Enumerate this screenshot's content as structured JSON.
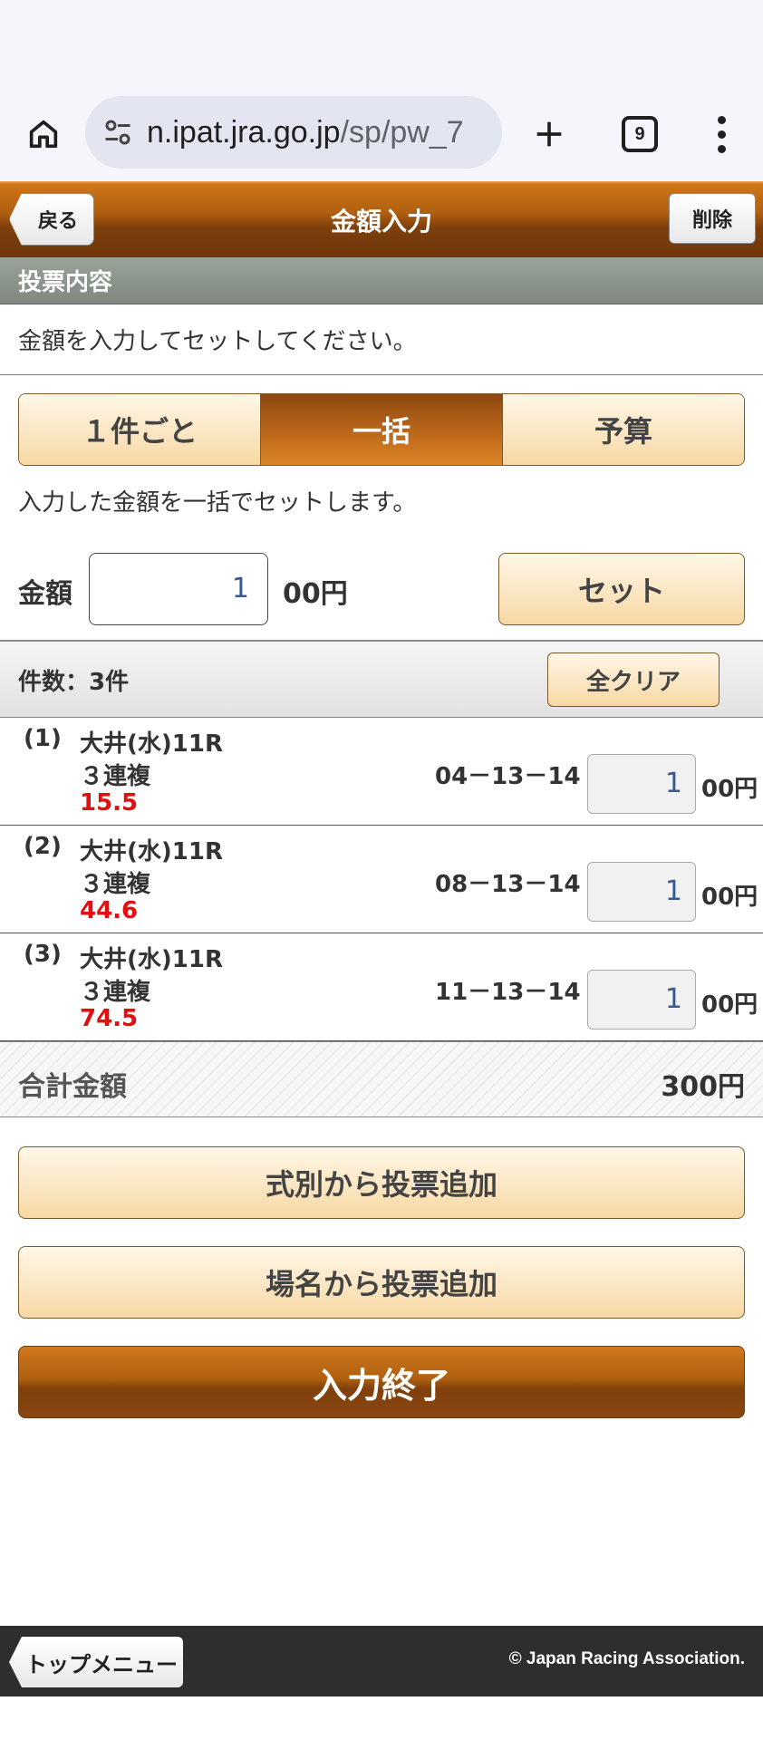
{
  "browser": {
    "url_host": "n.ipat.jra.go.jp",
    "url_path": "/sp/pw_7",
    "tab_count": "9",
    "icons": [
      "home-icon",
      "site-settings-icon",
      "plus-icon",
      "tabs-icon",
      "more-vert-icon"
    ]
  },
  "header": {
    "back_label": "戻る",
    "title": "金額入力",
    "delete_label": "削除"
  },
  "section": {
    "title": "投票内容",
    "instruction": "金額を入力してセットしてください。"
  },
  "mode_tabs": [
    {
      "label": "１件ごと",
      "active": false
    },
    {
      "label": "一括",
      "active": true
    },
    {
      "label": "予算",
      "active": false
    }
  ],
  "mode_description": "入力した金額を一括でセットします。",
  "amount": {
    "label": "金額",
    "value": "1",
    "unit": "00円",
    "set_label": "セット"
  },
  "count": {
    "label": "件数：3件",
    "clear_label": "全クリア"
  },
  "bets": [
    {
      "num": "(1)",
      "race": "大井(水)11R",
      "type": "３連複",
      "odds": "15.5",
      "combo": "04－13－14",
      "value": "1",
      "unit": "00円"
    },
    {
      "num": "(2)",
      "race": "大井(水)11R",
      "type": "３連複",
      "odds": "44.6",
      "combo": "08－13－14",
      "value": "1",
      "unit": "00円"
    },
    {
      "num": "(3)",
      "race": "大井(水)11R",
      "type": "３連複",
      "odds": "74.5",
      "combo": "11－13－14",
      "value": "1",
      "unit": "00円"
    }
  ],
  "total": {
    "label": "合計金額",
    "value": "300円"
  },
  "actions": {
    "add_by_type": "式別から投票追加",
    "add_by_venue": "場名から投票追加",
    "finish": "入力終了"
  },
  "footer": {
    "top_menu_label": "トップメニュー",
    "copyright": "© Japan Racing Association."
  },
  "colors": {
    "header_orange": "#b0600f",
    "odds_red": "#e01010",
    "button_cream": "#f7d8a3",
    "section_gray": "#8a928a"
  }
}
